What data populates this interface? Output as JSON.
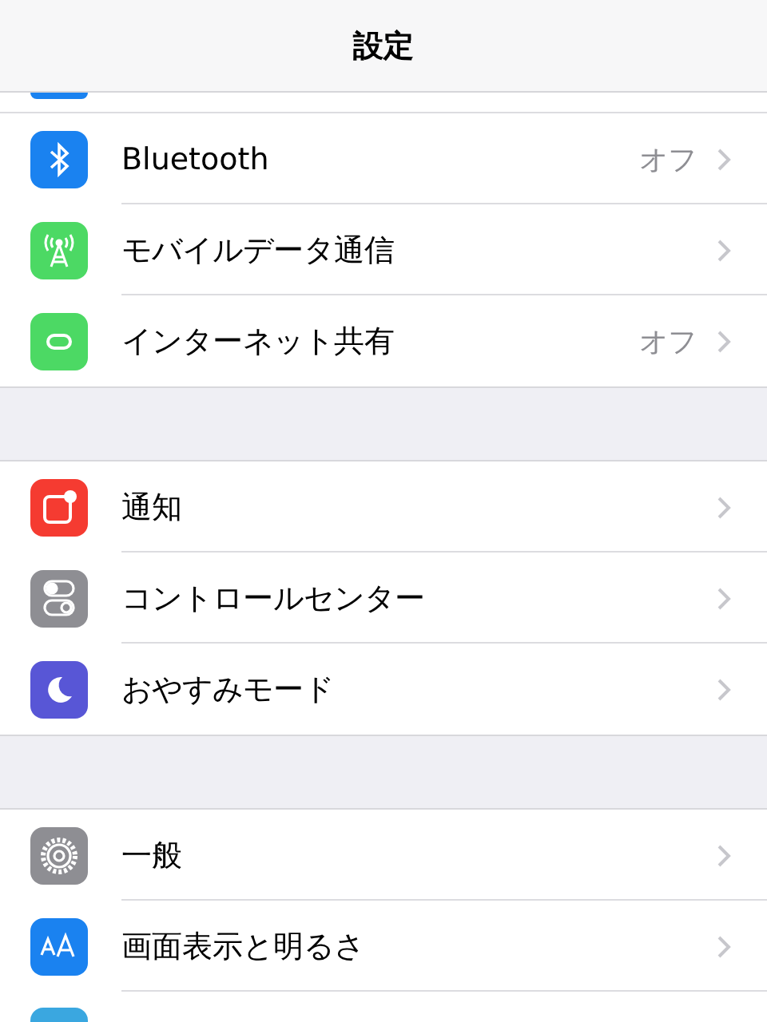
{
  "nav_bar": {
    "title": "設定"
  },
  "groups": [
    {
      "rows": [
        {
          "label": "Bluetooth",
          "value": "オフ"
        },
        {
          "label": "モバイルデータ通信"
        },
        {
          "label": "インターネット共有",
          "value": "オフ"
        }
      ]
    },
    {
      "rows": [
        {
          "label": "通知"
        },
        {
          "label": "コントロールセンター"
        },
        {
          "label": "おやすみモード"
        }
      ]
    },
    {
      "rows": [
        {
          "label": "一般"
        },
        {
          "label": "画面表示と明るさ"
        }
      ]
    }
  ]
}
